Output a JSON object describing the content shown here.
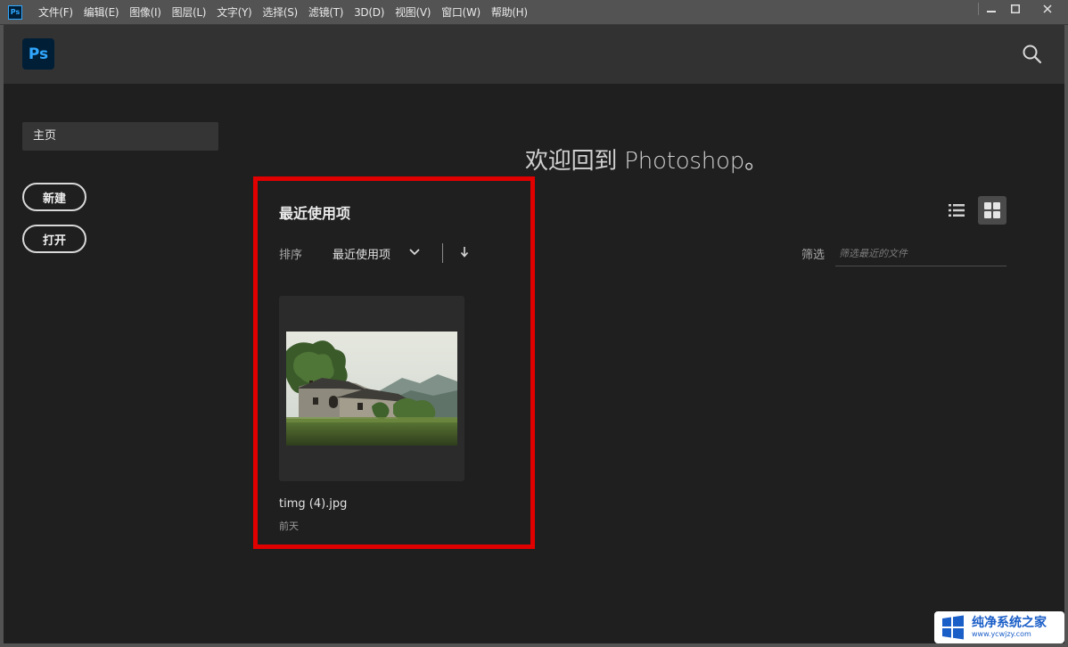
{
  "window": {
    "app_icon_text": "Ps",
    "menu": [
      "文件(F)",
      "编辑(E)",
      "图像(I)",
      "图层(L)",
      "文字(Y)",
      "选择(S)",
      "滤镜(T)",
      "3D(D)",
      "视图(V)",
      "窗口(W)",
      "帮助(H)"
    ],
    "controls": {
      "minimize": "—",
      "maximize": "☐",
      "close": "✕"
    }
  },
  "header": {
    "logo_text": "Ps",
    "search_icon": "search-icon"
  },
  "sidebar": {
    "home_label": "主页",
    "new_label": "新建",
    "open_label": "打开"
  },
  "main": {
    "welcome": "欢迎回到 Photoshop。",
    "recent_title": "最近使用项",
    "sort_label": "排序",
    "sort_value": "最近使用项",
    "filter_label": "筛选",
    "filter_placeholder": "筛选最近的文件",
    "files": [
      {
        "name": "timg (4).jpg",
        "date": "前天"
      }
    ]
  },
  "watermark": {
    "title": "纯净系统之家",
    "url": "www.ycwjzy.com"
  },
  "colors": {
    "highlight": "#e00000",
    "accent": "#31a8ff"
  }
}
